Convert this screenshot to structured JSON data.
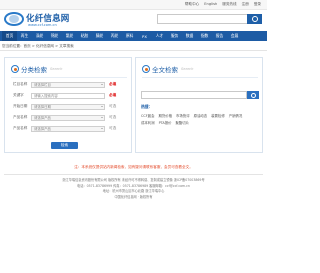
{
  "top_links": [
    "帮助中心",
    "English",
    "服务热线",
    "注册",
    "登录"
  ],
  "logo": {
    "cn": "化纤信息网",
    "en": "www.ccf.com.cn"
  },
  "nav": [
    "首页",
    "再生",
    "涤纶",
    "锦纶",
    "氨纶",
    "粘胶",
    "腈纶",
    "丙纶",
    "原料",
    "PX",
    "人才",
    "服务",
    "数据",
    "指数",
    "报告",
    "会展"
  ],
  "breadcrumb": "您当前位置：首页 > 化纤信息网 > 文章搜索",
  "classified": {
    "title": "分类检索",
    "subtitle": "Search",
    "rows": [
      {
        "label": "栏目名称",
        "value": "请选择栏目",
        "tag": "必填",
        "required": true
      },
      {
        "label": "关键字",
        "value": "请输入搜索内容",
        "tag": "必填",
        "required": true
      },
      {
        "label": "开始日期",
        "value": "请选择日期",
        "tag": "可选",
        "required": false
      },
      {
        "label": "产品名称",
        "value": "请选择产品",
        "tag": "可选",
        "required": false
      },
      {
        "label": "产品名称",
        "value": "请选择产品",
        "tag": "可选",
        "required": false
      }
    ],
    "button": "检索"
  },
  "fulltext": {
    "title": "全文检索",
    "subtitle": "Search",
    "input_placeholder": "",
    "hot_label": "热搜：",
    "hot_row1": [
      "CCF晨会",
      "期货价格",
      "市场快评",
      "原油动态",
      "装置检修",
      "产销情况"
    ],
    "hot_row2": [
      "成本利润",
      "PTA报价",
      "聚酯切片"
    ]
  },
  "notice": "注：本系统仅提供站内新闻检索，如有疑问请联系客服，会员可查看全文。",
  "footer": [
    "浙江华瑞信息资讯股份有限公司 版权所有 未经许可不得转载、复制或建立镜像 浙ICP备07003869号",
    "电话：0571-83786999  传真：0571-83786989  客服邮箱：ccf@ccf.com.cn",
    "地址：杭州市萧山区市心北路 浙江华瑞中心",
    "中国化纤信息网 · 版权所有"
  ],
  "colors": {
    "brand": "#1d5ba4",
    "accent": "#e34a2a"
  }
}
